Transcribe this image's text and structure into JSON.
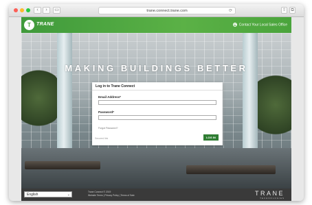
{
  "browser": {
    "url": "trane.connect.trane.com",
    "back_glyph": "‹",
    "forward_glyph": "›",
    "reload_glyph": "⟳",
    "sidebar_glyph": "▭",
    "share_glyph": "⇧",
    "tabs_glyph": "⧉"
  },
  "header": {
    "logo_mark": "T",
    "logo_text": "TRANE",
    "contact_link": "Contact Your Local Sales Office",
    "contact_icon_glyph": "☎"
  },
  "hero": {
    "tagline": "MAKING BUILDINGS BETTER"
  },
  "login": {
    "title": "Log in to Trane Connect",
    "email_label": "Email Address*",
    "email_value": "",
    "password_label": "Password*",
    "password_value": "",
    "forgot_link": "Forgot Password?",
    "secure_text": "Secured link",
    "submit_label": "LOG IN"
  },
  "footer": {
    "language_value": "English",
    "language_arrow": "⌄",
    "copyright": "Trane Connect © 2019",
    "links": "Website Terms | Privacy Policy | Terms of Sale",
    "brand": "TRANE",
    "brand_sub": "TECHNOLOGIES"
  },
  "colors": {
    "header_green": "#4aa43c",
    "button_green": "#2f7d33"
  }
}
